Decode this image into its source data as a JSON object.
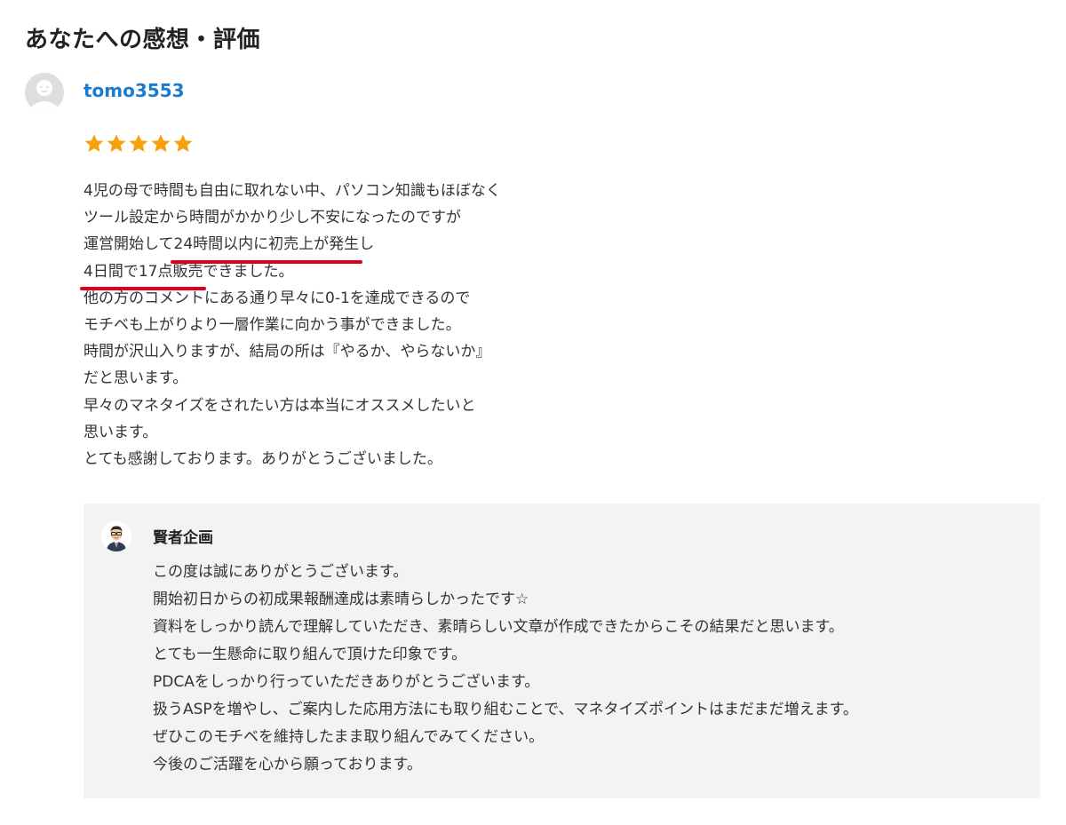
{
  "section_title": "あなたへの感想・評価",
  "reviewer": {
    "name": "tomo3553",
    "rating": 5,
    "rating_max": 5,
    "star_color": "#f7a10e",
    "name_color": "#1a7bd0"
  },
  "review_lines": [
    [
      "4児の母で時間も自由に取れない中、パソコン知識もほぼなく"
    ],
    [
      "ツール設定から時間がかかり少し不安になったのですが"
    ],
    [
      "運営開始して",
      {
        "hl": "24時間以内に初売上が発生"
      },
      "し"
    ],
    [
      {
        "hl": "4日間で17点販売"
      },
      "できました。"
    ],
    [
      "他の方のコメントにある通り早々に0-1を達成できるので"
    ],
    [
      "モチベも上がりより一層作業に向かう事ができました。"
    ],
    [
      "時間が沢山入りますが、結局の所は『やるか、やらないか』"
    ],
    [
      "だと思います。"
    ],
    [
      "早々のマネタイズをされたい方は本当にオススメしたいと"
    ],
    [
      "思います。"
    ],
    [
      "とても感謝しております。ありがとうございました。"
    ]
  ],
  "reply": {
    "seller_name": "賢者企画",
    "lines": [
      "この度は誠にありがとうございます。",
      "開始初日からの初成果報酬達成は素晴らしかったです☆",
      "資料をしっかり読んで理解していただき、素晴らしい文章が作成できたからこその結果だと思います。",
      "とても一生懸命に取り組んで頂けた印象です。",
      "PDCAをしっかり行っていただきありがとうございます。",
      "扱うASPを増やし、ご案内した応用方法にも取り組むことで、マネタイズポイントはまだまだ増えます。",
      "ぜひこのモチベを維持したまま取り組んでみてください。",
      "今後のご活躍を心から願っております。"
    ]
  },
  "colors": {
    "highlight_underline": "#e0001b",
    "reply_background": "#f2f3f5"
  },
  "icons": {
    "reviewer_avatar": "default-user-avatar-icon",
    "seller_avatar": "seller-portrait-avatar",
    "star": "star-icon"
  }
}
